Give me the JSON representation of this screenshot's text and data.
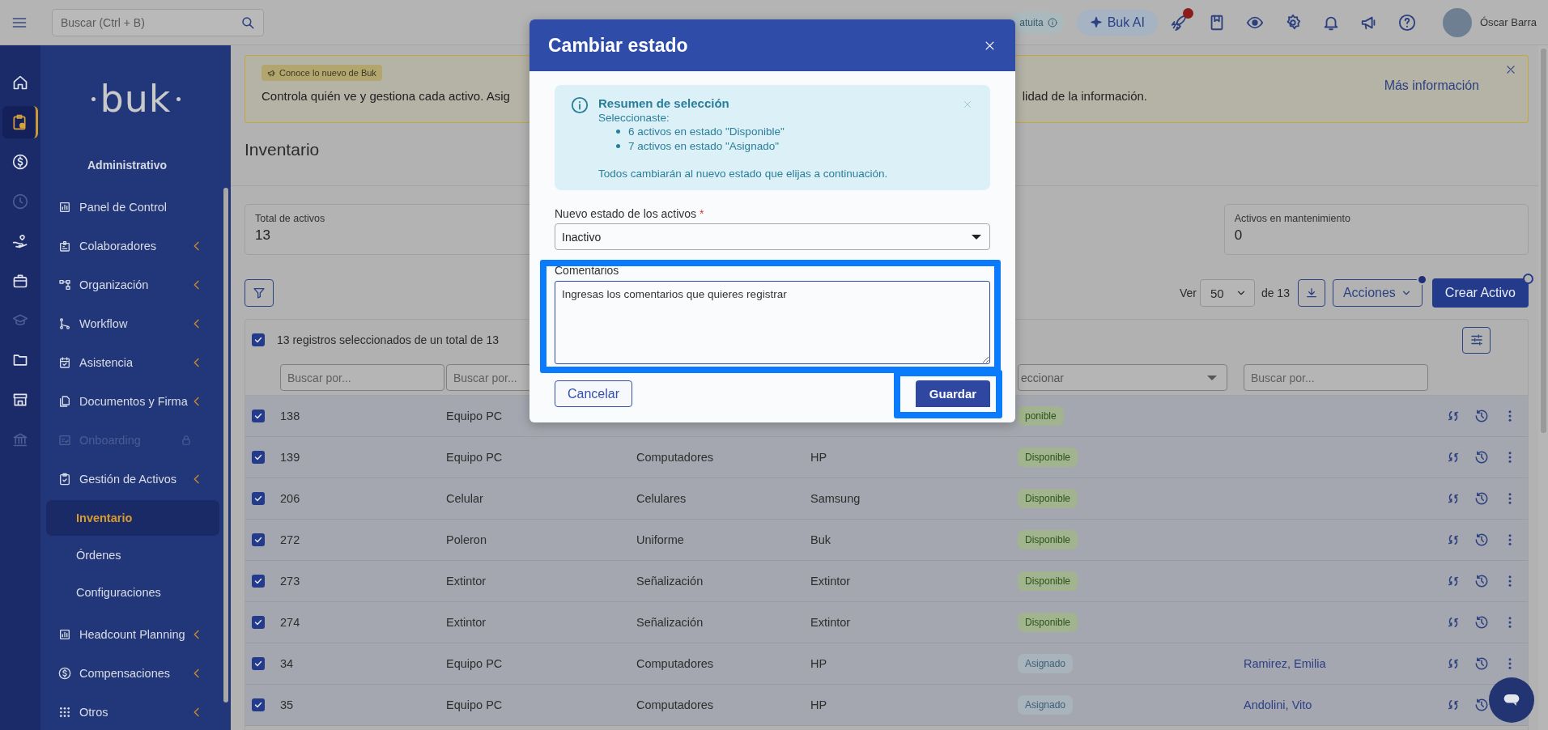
{
  "top_bar": {
    "search": {
      "placeholder": "Buscar (Ctrl + B)"
    },
    "trial_badge": "atuita",
    "ai_button": "Buk AI",
    "user_name": "Óscar Barra"
  },
  "icon_rail": [
    {
      "selected": false,
      "disabled": false
    },
    {
      "selected": true,
      "disabled": false
    },
    {
      "selected": false,
      "disabled": false
    },
    {
      "selected": false,
      "disabled": true
    },
    {
      "selected": false,
      "disabled": false
    },
    {
      "selected": false,
      "disabled": false
    },
    {
      "selected": false,
      "disabled": true
    },
    {
      "selected": false,
      "disabled": false
    },
    {
      "selected": false,
      "disabled": false
    },
    {
      "selected": false,
      "disabled": true
    }
  ],
  "sidebar": {
    "logo": "buk",
    "section": "Administrativo",
    "items": [
      {
        "label": "Panel de Control",
        "selected": false,
        "disabled": false,
        "submenu": false
      },
      {
        "label": "Colaboradores",
        "selected": false,
        "disabled": false,
        "submenu": true
      },
      {
        "label": "Organización",
        "selected": false,
        "disabled": false,
        "submenu": true
      },
      {
        "label": "Workflow",
        "selected": false,
        "disabled": false,
        "submenu": true
      },
      {
        "label": "Asistencia",
        "selected": false,
        "disabled": false,
        "submenu": true
      },
      {
        "label": "Documentos y Firma",
        "selected": false,
        "disabled": false,
        "submenu": true
      },
      {
        "label": "Onboarding",
        "selected": false,
        "disabled": true,
        "submenu": false
      },
      {
        "label": "Gestión de Activos",
        "selected": false,
        "disabled": false,
        "submenu": true,
        "children": [
          {
            "label": "Inventario",
            "selected": true
          },
          {
            "label": "Órdenes",
            "selected": false
          },
          {
            "label": "Configuraciones",
            "selected": false
          }
        ]
      },
      {
        "label": "Headcount Planning",
        "selected": false,
        "disabled": false,
        "submenu": true
      },
      {
        "label": "Compensaciones",
        "selected": false,
        "disabled": false,
        "submenu": true
      },
      {
        "label": "Otros",
        "selected": false,
        "disabled": false,
        "submenu": true
      }
    ]
  },
  "banner": {
    "tag": "Conoce lo nuevo de Buk",
    "text_left": "Controla quién ve y gestiona cada activo. Asig",
    "text_right": "lidad de la información.",
    "link": "Más información"
  },
  "page_title": "Inventario",
  "stats": [
    {
      "label": "Total de activos",
      "value": "13"
    },
    {
      "label": "Activos en mantenimiento",
      "value": "0"
    }
  ],
  "toolbar": {
    "per_page_label": "Ver",
    "per_page": "50",
    "total": "de 13",
    "actions_button": "Acciones",
    "create_button": "Crear Activo"
  },
  "table": {
    "all_checked": true,
    "selection_text": "13 registros seleccionados de un total de 13",
    "filters": [
      {
        "kind": "search",
        "placeholder": "Buscar por..."
      },
      {
        "kind": "search",
        "placeholder": "Buscar por..."
      },
      {
        "kind": "covered"
      },
      {
        "kind": "covered"
      },
      {
        "kind": "select",
        "placeholder": "eccionar"
      },
      {
        "kind": "search",
        "placeholder": "Buscar por..."
      }
    ],
    "rows": [
      {
        "checked": true,
        "id": "138",
        "name": "Equipo PC",
        "status": {
          "label": "ponible",
          "kind": "available"
        }
      },
      {
        "checked": true,
        "id": "139",
        "name": "Equipo PC",
        "category": "Computadores",
        "brand": "HP",
        "status": {
          "label": "Disponible",
          "kind": "available"
        }
      },
      {
        "checked": true,
        "id": "206",
        "name": "Celular",
        "category": "Celulares",
        "brand": "Samsung",
        "status": {
          "label": "Disponible",
          "kind": "available"
        }
      },
      {
        "checked": true,
        "id": "272",
        "name": "Poleron",
        "category": "Uniforme",
        "brand": "Buk",
        "status": {
          "label": "Disponible",
          "kind": "available"
        }
      },
      {
        "checked": true,
        "id": "273",
        "name": "Extintor",
        "category": "Señalización",
        "brand": "Extintor",
        "status": {
          "label": "Disponible",
          "kind": "available"
        }
      },
      {
        "checked": true,
        "id": "274",
        "name": "Extintor",
        "category": "Señalización",
        "brand": "Extintor",
        "status": {
          "label": "Disponible",
          "kind": "available"
        }
      },
      {
        "checked": true,
        "id": "34",
        "name": "Equipo PC",
        "category": "Computadores",
        "brand": "HP",
        "status": {
          "label": "Asignado",
          "kind": "assigned"
        },
        "assignee": "Ramirez, Emilia"
      },
      {
        "checked": true,
        "id": "35",
        "name": "Equipo PC",
        "category": "Computadores",
        "brand": "HP",
        "status": {
          "label": "Asignado",
          "kind": "assigned"
        },
        "assignee": "Andolini, Vito"
      }
    ]
  },
  "modal": {
    "title": "Cambiar estado",
    "info": {
      "title": "Resumen de selección",
      "intro": "Seleccionaste:",
      "bullets": [
        "6 activos en estado \"Disponible\"",
        "7 activos en estado \"Asignado\""
      ],
      "note": "Todos cambiarán al nuevo estado que elijas a continuación."
    },
    "status_field": {
      "label": "Nuevo estado de los activos",
      "required_mark": "*",
      "value": "Inactivo"
    },
    "comments": {
      "label": "Comentarios",
      "placeholder": "Ingresas los comentarios que quieres registrar"
    },
    "cancel_button": "Cancelar",
    "save_button": "Guardar"
  }
}
